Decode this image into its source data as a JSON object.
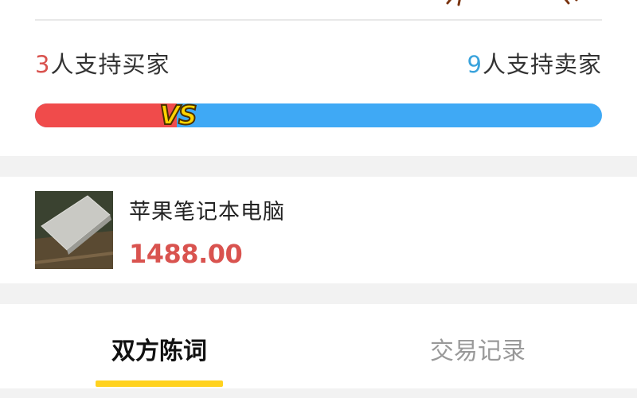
{
  "vote": {
    "buyer_count": "3",
    "buyer_text": "人支持买家",
    "seller_count": "9",
    "seller_text": "人支持卖家",
    "vs_label": "VS",
    "buyer_ratio": 0.25,
    "colors": {
      "buyer": "#f04b4b",
      "seller": "#3fa9f5",
      "vs": "#ffd400"
    }
  },
  "product": {
    "title": "苹果笔记本电脑",
    "price": "1488.00"
  },
  "tabs": [
    {
      "label": "双方陈词",
      "active": true
    },
    {
      "label": "交易记录",
      "active": false
    }
  ]
}
